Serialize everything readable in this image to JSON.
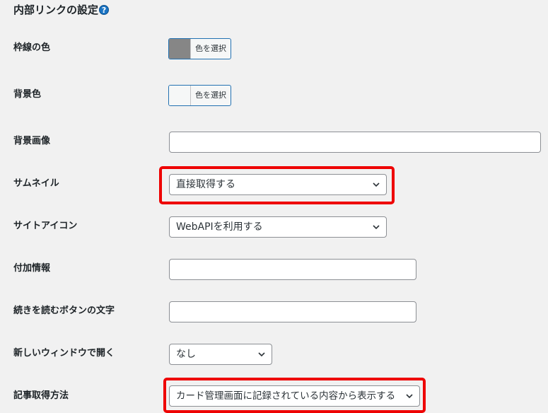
{
  "section": {
    "title": "内部リンクの設定",
    "help_icon_glyph": "?"
  },
  "border_color": {
    "label": "枠線の色",
    "button_label": "色を選択",
    "swatch_color": "#868686"
  },
  "background_color": {
    "label": "背景色",
    "button_label": "色を選択",
    "swatch_color": "#f6f7f7"
  },
  "background_image": {
    "label": "背景画像",
    "value": ""
  },
  "thumbnail": {
    "label": "サムネイル",
    "selected": "直接取得する"
  },
  "site_icon": {
    "label": "サイトアイコン",
    "selected": "WebAPIを利用する"
  },
  "additional_info": {
    "label": "付加情報",
    "value": ""
  },
  "read_more_text": {
    "label": "続きを読むボタンの文字",
    "value": ""
  },
  "new_window": {
    "label": "新しいウィンドウで開く",
    "selected": "なし"
  },
  "article_fetch": {
    "label": "記事取得方法",
    "selected": "カード管理画面に記録されている内容から表示する"
  },
  "colors": {
    "accent": "#2271b1",
    "highlight": "#ee0000"
  }
}
